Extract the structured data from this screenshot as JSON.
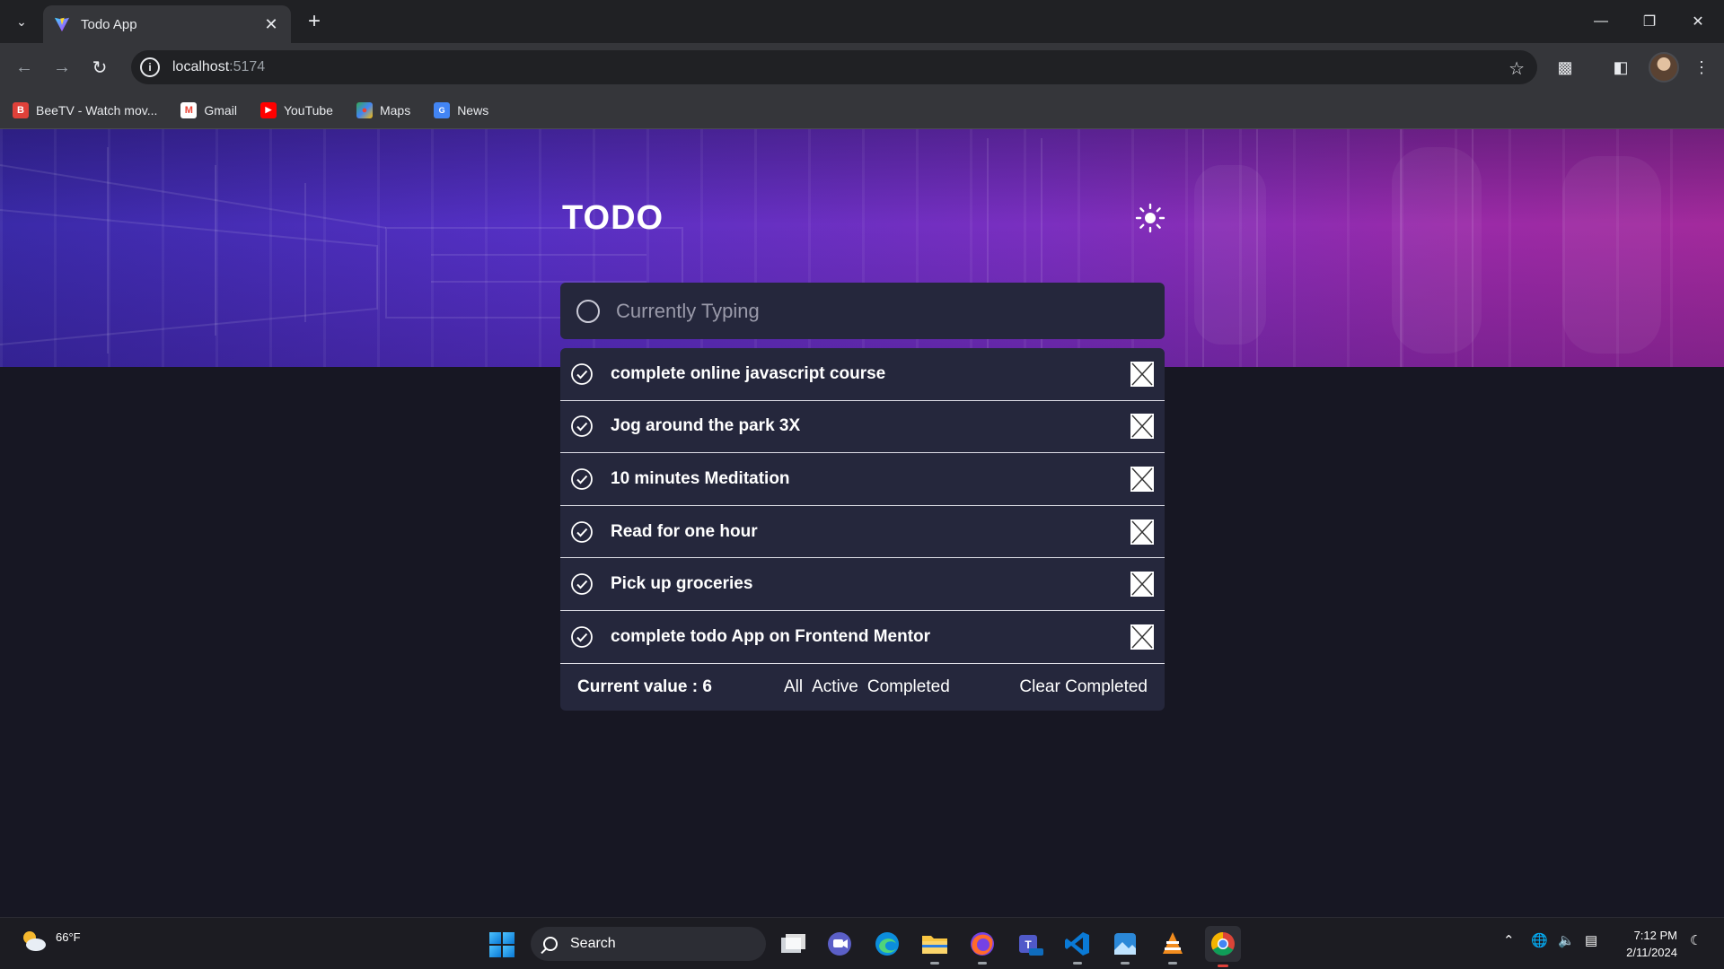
{
  "browser": {
    "tab_title": "Todo App",
    "url_host": "localhost",
    "url_port": ":5174",
    "bookmarks": [
      {
        "label": "BeeTV - Watch mov...",
        "icon": "beetv-icon",
        "color": "#e0413a"
      },
      {
        "label": "Gmail",
        "icon": "gmail-icon",
        "color": "#ea4335"
      },
      {
        "label": "YouTube",
        "icon": "youtube-icon",
        "color": "#ff0000"
      },
      {
        "label": "Maps",
        "icon": "maps-icon",
        "color": "#34a853"
      },
      {
        "label": "News",
        "icon": "news-icon",
        "color": "#4285f4"
      }
    ]
  },
  "app": {
    "title": "TODO",
    "theme_icon": "sun-icon",
    "new_todo": {
      "placeholder": "Currently Typing",
      "value": ""
    },
    "todos": [
      {
        "text": "complete online javascript course"
      },
      {
        "text": "Jog around the park 3X"
      },
      {
        "text": "10 minutes Meditation"
      },
      {
        "text": "Read for one hour"
      },
      {
        "text": "Pick up groceries"
      },
      {
        "text": "complete todo App on Frontend Mentor"
      }
    ],
    "footer": {
      "count_label": "Current value : 6",
      "filters": [
        "All",
        "Active",
        "Completed"
      ],
      "clear_label": "Clear Completed"
    },
    "colors": {
      "background": "#171723",
      "card": "#25273c",
      "hero_start": "#3a2aa8",
      "hero_end": "#a32a9c"
    }
  },
  "taskbar": {
    "weather_temp": "66°F",
    "search_label": "Search",
    "time": "7:12 PM",
    "date": "2/11/2024"
  }
}
